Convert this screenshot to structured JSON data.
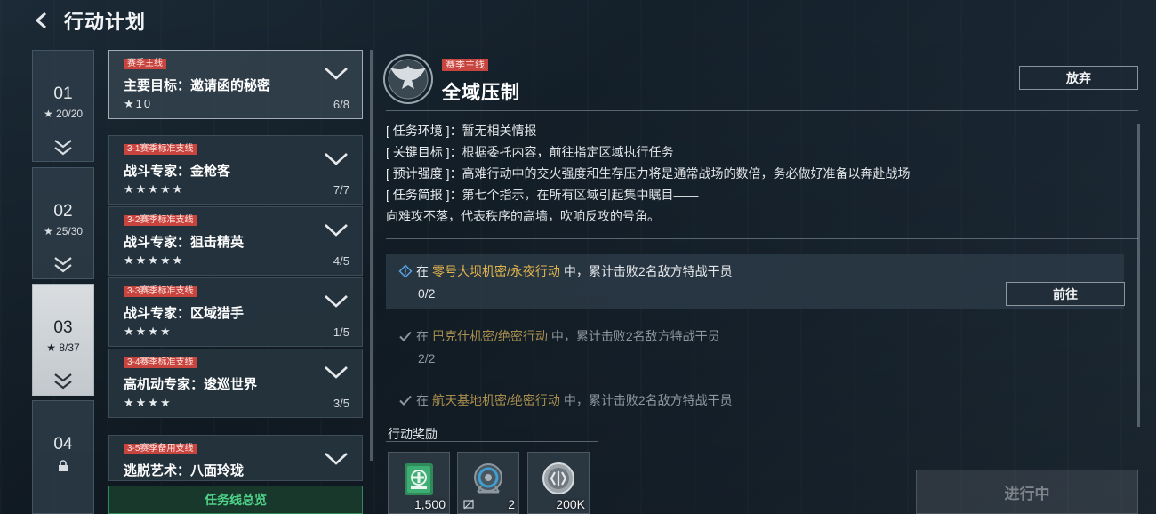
{
  "header": {
    "title": "行动计划"
  },
  "chapters": [
    {
      "number": "01",
      "stars": "20/20",
      "locked": false,
      "active": false
    },
    {
      "number": "02",
      "stars": "25/30",
      "locked": false,
      "active": false
    },
    {
      "number": "03",
      "stars": "8/37",
      "locked": false,
      "active": true
    },
    {
      "number": "04",
      "stars": "",
      "locked": true,
      "active": false
    }
  ],
  "missions": [
    {
      "tag": "赛季主线",
      "name": "主要目标：邀请函的秘密",
      "stars": "★10",
      "progress": "6/8",
      "selected": true
    },
    {
      "tag": "3-1赛季标准支线",
      "name": "战斗专家：金枪客",
      "stars": "★★★★★",
      "progress": "7/7"
    },
    {
      "tag": "3-2赛季标准支线",
      "name": "战斗专家：狙击精英",
      "stars": "★★★★★",
      "progress": "4/5"
    },
    {
      "tag": "3-3赛季标准支线",
      "name": "战斗专家：区域猎手",
      "stars": "★★★★",
      "progress": "1/5"
    },
    {
      "tag": "3-4赛季标准支线",
      "name": "高机动专家：逡巡世界",
      "stars": "★★★★",
      "progress": "3/5"
    },
    {
      "tag": "3-5赛季备用支线",
      "name": "逃脱艺术：八面玲珑",
      "stars": "",
      "progress": ""
    }
  ],
  "overview_button": "任务线总览",
  "detail": {
    "tag": "赛季主线",
    "title": "全域压制",
    "abandon_label": "放弃",
    "info": [
      {
        "key": "[ 任务环境 ]",
        "value": "：暂无相关情报"
      },
      {
        "key": "[ 关键目标 ]",
        "value": "：根据委托内容，前往指定区域执行任务"
      },
      {
        "key": "[ 预计强度 ]",
        "value": "：高难行动中的交火强度和生存压力将是通常战场的数倍，务必做好准备以奔赴战场"
      },
      {
        "key": "[ 任务简报 ]",
        "value": "：第七个指示，在所有区域引起集中瞩目——"
      },
      {
        "key": "",
        "value": "向难攻不落，代表秩序的高墙，吹响反攻的号角。"
      }
    ],
    "tasks": [
      {
        "prefix": "在",
        "highlight": "零号大坝机密/永夜行动",
        "suffix": "中，累计击败2名敌方特战干员",
        "progress": "0/2",
        "done": false,
        "button": "前往"
      },
      {
        "prefix": "在",
        "highlight": "巴克什机密/绝密行动",
        "suffix": "中，累计击败2名敌方特战干员",
        "progress": "2/2",
        "done": true
      },
      {
        "prefix": "在",
        "highlight": "航天基地机密/绝密行动",
        "suffix": "中，累计击败2名敌方特战干员",
        "progress": "",
        "done": true
      }
    ],
    "reward_label": "行动奖励",
    "rewards": [
      {
        "icon": "medkit-icon",
        "count": "1,500"
      },
      {
        "icon": "cable-reel-icon",
        "count": "2"
      },
      {
        "icon": "coin-icon",
        "count": "200K"
      }
    ],
    "status_label": "进行中"
  },
  "colors": {
    "tag_red": "#c8443e",
    "highlight_gold": "#e2b44c",
    "overview_green": "#4fd38a"
  }
}
